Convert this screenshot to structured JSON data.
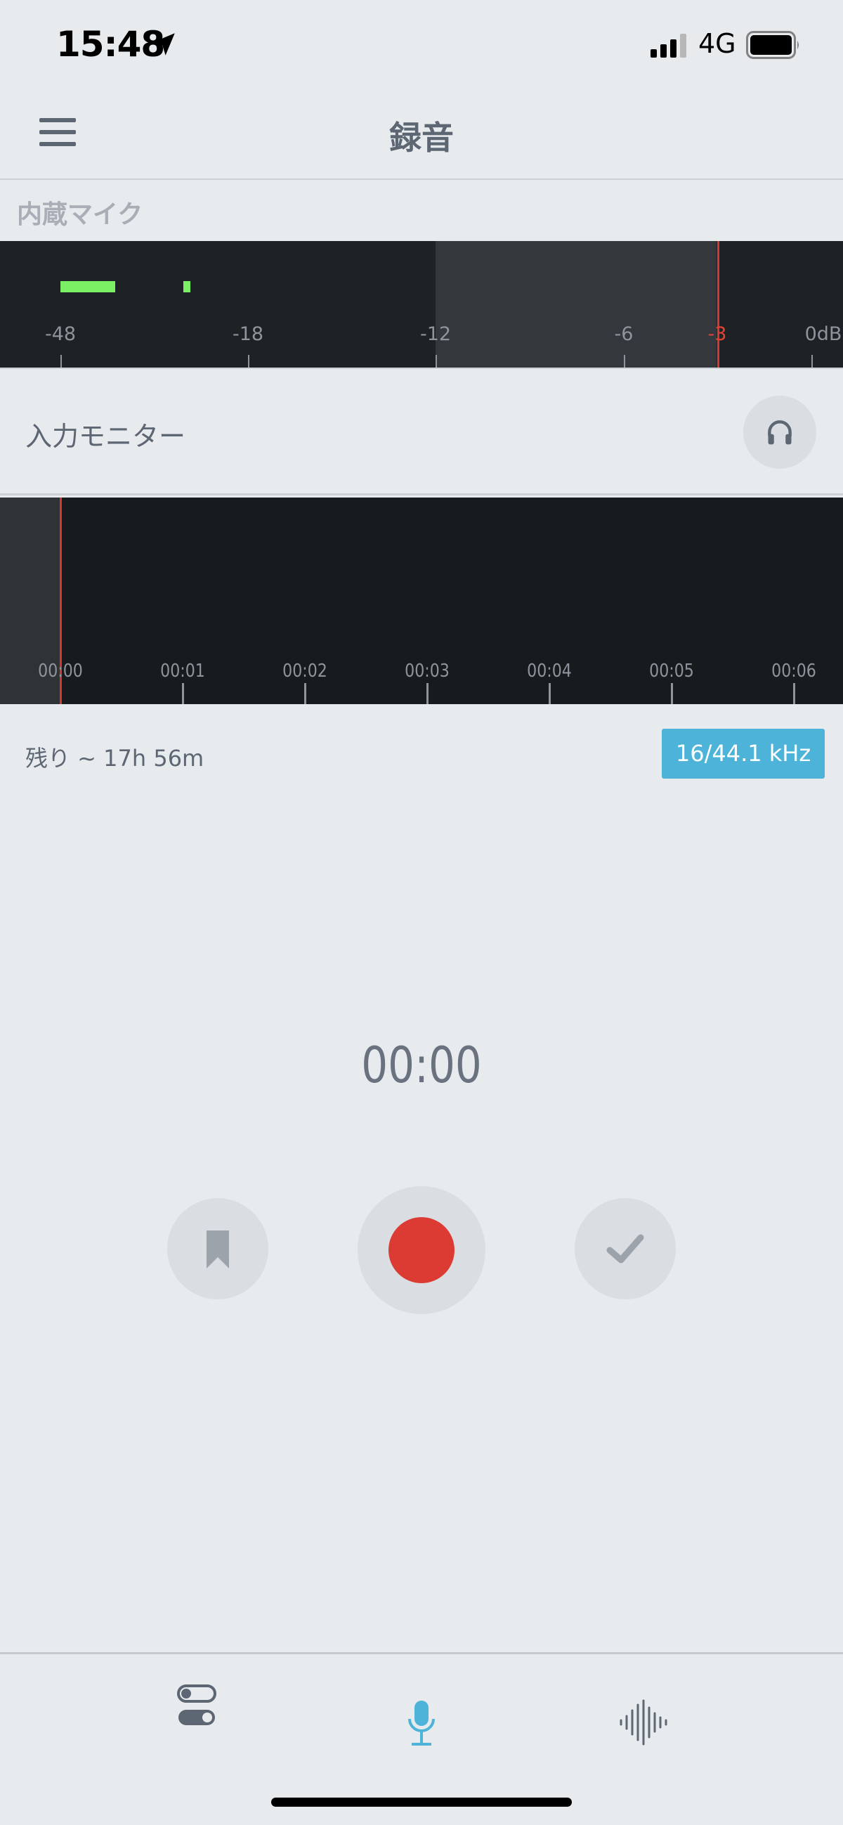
{
  "status_bar": {
    "time": "15:48",
    "network": "4G"
  },
  "header": {
    "title": "録音"
  },
  "input_source": {
    "label": "内蔵マイク"
  },
  "level_meter": {
    "scale_labels": [
      "-48",
      "-18",
      "-12",
      "-6",
      "-3",
      "0dB"
    ],
    "peak_label": "-3",
    "level_color": "#7cf065",
    "peak_color": "#d6382f"
  },
  "monitor": {
    "label": "入力モニター",
    "icon": "headphones-icon"
  },
  "timeline": {
    "labels": [
      "00:00",
      "00:01",
      "00:02",
      "00:03",
      "00:04",
      "00:05",
      "00:06"
    ]
  },
  "info": {
    "remaining": "残り ~ 17h 56m",
    "sample_rate": "16/44.1 kHz"
  },
  "timer": {
    "value": "00:00"
  },
  "controls": {
    "bookmark_icon": "bookmark-icon",
    "record_icon": "record-icon",
    "done_icon": "checkmark-icon",
    "record_color": "#db3b32"
  },
  "tab_bar": {
    "tabs": [
      {
        "icon": "toggles-icon",
        "active": false
      },
      {
        "icon": "microphone-icon",
        "active": true
      },
      {
        "icon": "waveform-icon",
        "active": false
      }
    ],
    "active_color": "#4db3d8"
  }
}
